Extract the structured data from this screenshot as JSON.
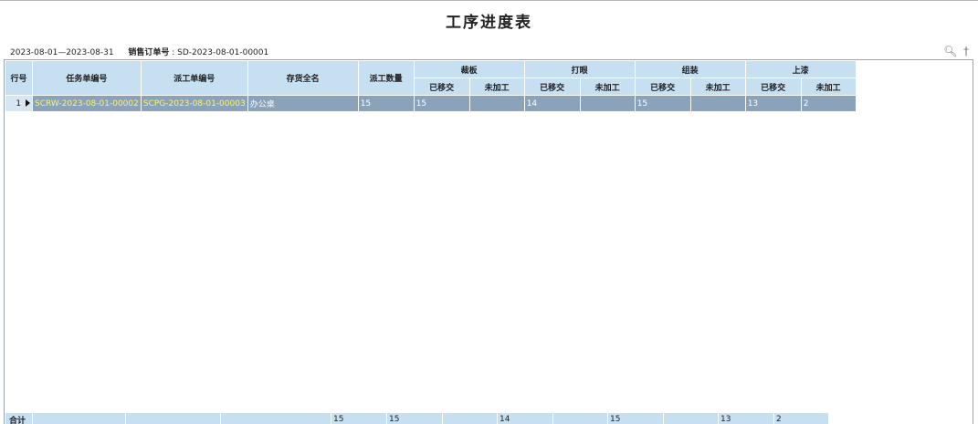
{
  "title": "工序进度表",
  "filter": {
    "date_range": "2023-08-01—2023-08-31",
    "order_label": "销售订单号",
    "order_value": "SD-2023-08-01-00001"
  },
  "icons": {
    "zoom": "zoom-icon",
    "pin": "pin-icon"
  },
  "headers": {
    "row_no": "行号",
    "task_no": "任务单编号",
    "dispatch_no": "派工单编号",
    "item_name": "存货全名",
    "dispatch_qty": "派工数量",
    "groups": [
      "裁板",
      "打眼",
      "组装",
      "上漆"
    ],
    "sub": [
      "已移交",
      "未加工"
    ]
  },
  "rows": [
    {
      "row_no": "1",
      "task_no": "SCRW-2023-08-01-00002",
      "dispatch_no": "SCPG-2023-08-01-00003",
      "item_name": "办公桌",
      "dispatch_qty": "15",
      "steps": [
        {
          "moved": "15",
          "pending": ""
        },
        {
          "moved": "14",
          "pending": ""
        },
        {
          "moved": "15",
          "pending": ""
        },
        {
          "moved": "13",
          "pending": "2"
        }
      ]
    }
  ],
  "totals": {
    "label": "合计",
    "dispatch_qty": "15",
    "steps": [
      {
        "moved": "15",
        "pending": ""
      },
      {
        "moved": "14",
        "pending": ""
      },
      {
        "moved": "15",
        "pending": ""
      },
      {
        "moved": "13",
        "pending": "2"
      }
    ]
  },
  "colors": {
    "header_bg": "#c6dff1",
    "selected_row": "#8aa2ba",
    "link_text": "#fff36a"
  }
}
